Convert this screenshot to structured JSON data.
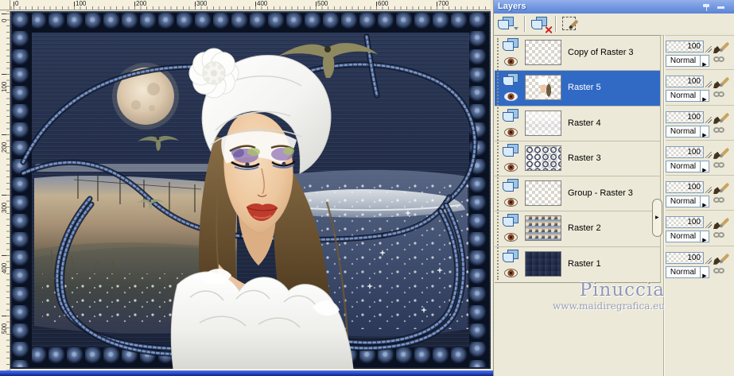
{
  "panel": {
    "title": "Layers",
    "combo_arrow": "▶",
    "splitter_arrow": "▶",
    "toolbar_icons": [
      "new-layer-icon",
      "delete-layer-icon",
      "edit-selection-icon"
    ],
    "titlebar_icons": [
      "pin-icon",
      "minimize-icon"
    ],
    "layers": [
      {
        "name": "Copy of Raster 3",
        "opacity": "100",
        "blend_mode": "Normal",
        "selected": false,
        "thumb": "transparent"
      },
      {
        "name": "Raster 5",
        "opacity": "100",
        "blend_mode": "Normal",
        "selected": true,
        "thumb": "portrait"
      },
      {
        "name": "Raster 4",
        "opacity": "100",
        "blend_mode": "Normal",
        "selected": false,
        "thumb": "faint"
      },
      {
        "name": "Raster 3",
        "opacity": "100",
        "blend_mode": "Normal",
        "selected": false,
        "thumb": "bead-frame"
      },
      {
        "name": "Group - Raster 3",
        "opacity": "100",
        "blend_mode": "Normal",
        "selected": false,
        "thumb": "transparent"
      },
      {
        "name": "Raster 2",
        "opacity": "100",
        "blend_mode": "Normal",
        "selected": false,
        "thumb": "beach"
      },
      {
        "name": "Raster 1",
        "opacity": "100",
        "blend_mode": "Normal",
        "selected": false,
        "thumb": "solid-navy"
      }
    ]
  },
  "rulers": {
    "horizontal": [
      "0",
      "100",
      "200",
      "300",
      "400",
      "500",
      "600",
      "700"
    ],
    "vertical": [
      "0",
      "100",
      "200",
      "300",
      "400",
      "500"
    ]
  },
  "watermark": {
    "title": "Pinuccia",
    "url": "www.maidiregrafica.eu"
  },
  "colors": {
    "selection": "#316ac5",
    "titlebar": "#7499e2",
    "panel_bg": "#ece9d8",
    "canvas_navy": "#232e4a",
    "bottom_band": "#2446c0",
    "watermark": "#8f96b5"
  }
}
